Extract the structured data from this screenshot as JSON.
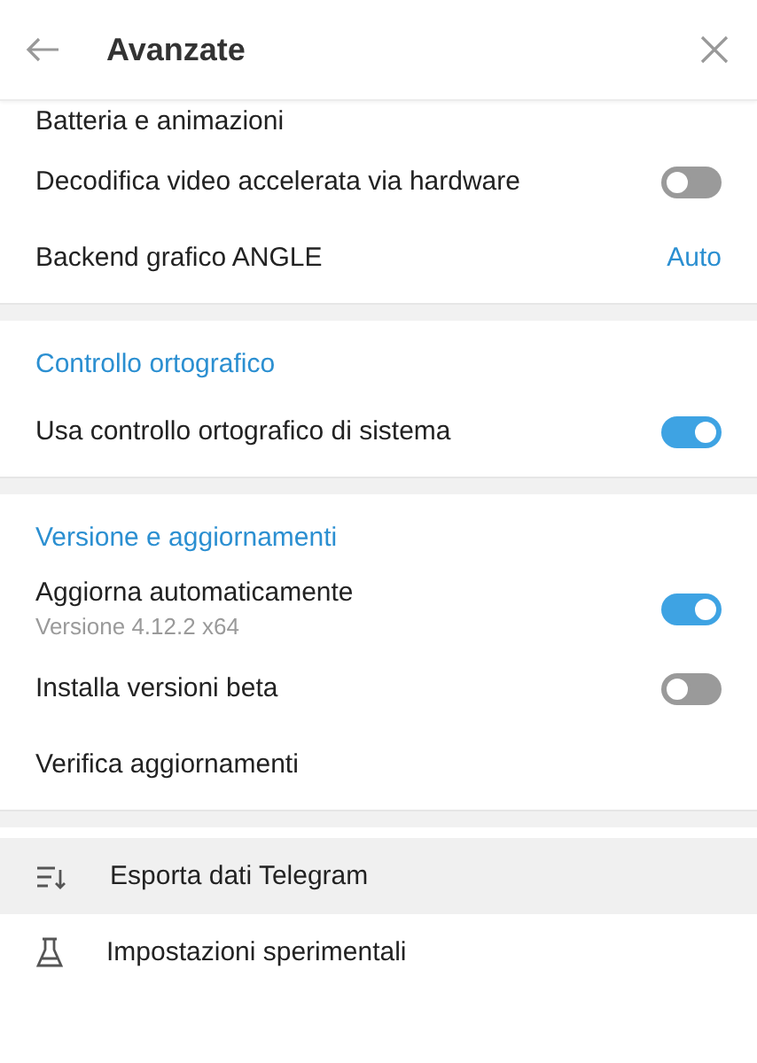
{
  "header": {
    "title": "Avanzate"
  },
  "sections": [
    {
      "rows": [
        {
          "kind": "plain",
          "label": "Batteria e animazioni"
        },
        {
          "kind": "toggle",
          "label": "Decodifica video accelerata via hardware",
          "on": false
        },
        {
          "kind": "value",
          "label": "Backend grafico ANGLE",
          "value": "Auto"
        }
      ]
    },
    {
      "heading": "Controllo ortografico",
      "rows": [
        {
          "kind": "toggle",
          "label": "Usa controllo ortografico di sistema",
          "on": true
        }
      ]
    },
    {
      "heading": "Versione e aggiornamenti",
      "rows": [
        {
          "kind": "toggle",
          "label": "Aggiorna automaticamente",
          "subtitle": "Versione 4.12.2 x64",
          "on": true
        },
        {
          "kind": "toggle",
          "label": "Installa versioni beta",
          "on": false
        },
        {
          "kind": "plain",
          "label": "Verifica aggiornamenti"
        }
      ]
    }
  ],
  "menu": [
    {
      "kind": "export",
      "label": "Esporta dati Telegram",
      "selected": true
    },
    {
      "kind": "lab",
      "label": "Impostazioni sperimentali",
      "selected": false
    }
  ]
}
